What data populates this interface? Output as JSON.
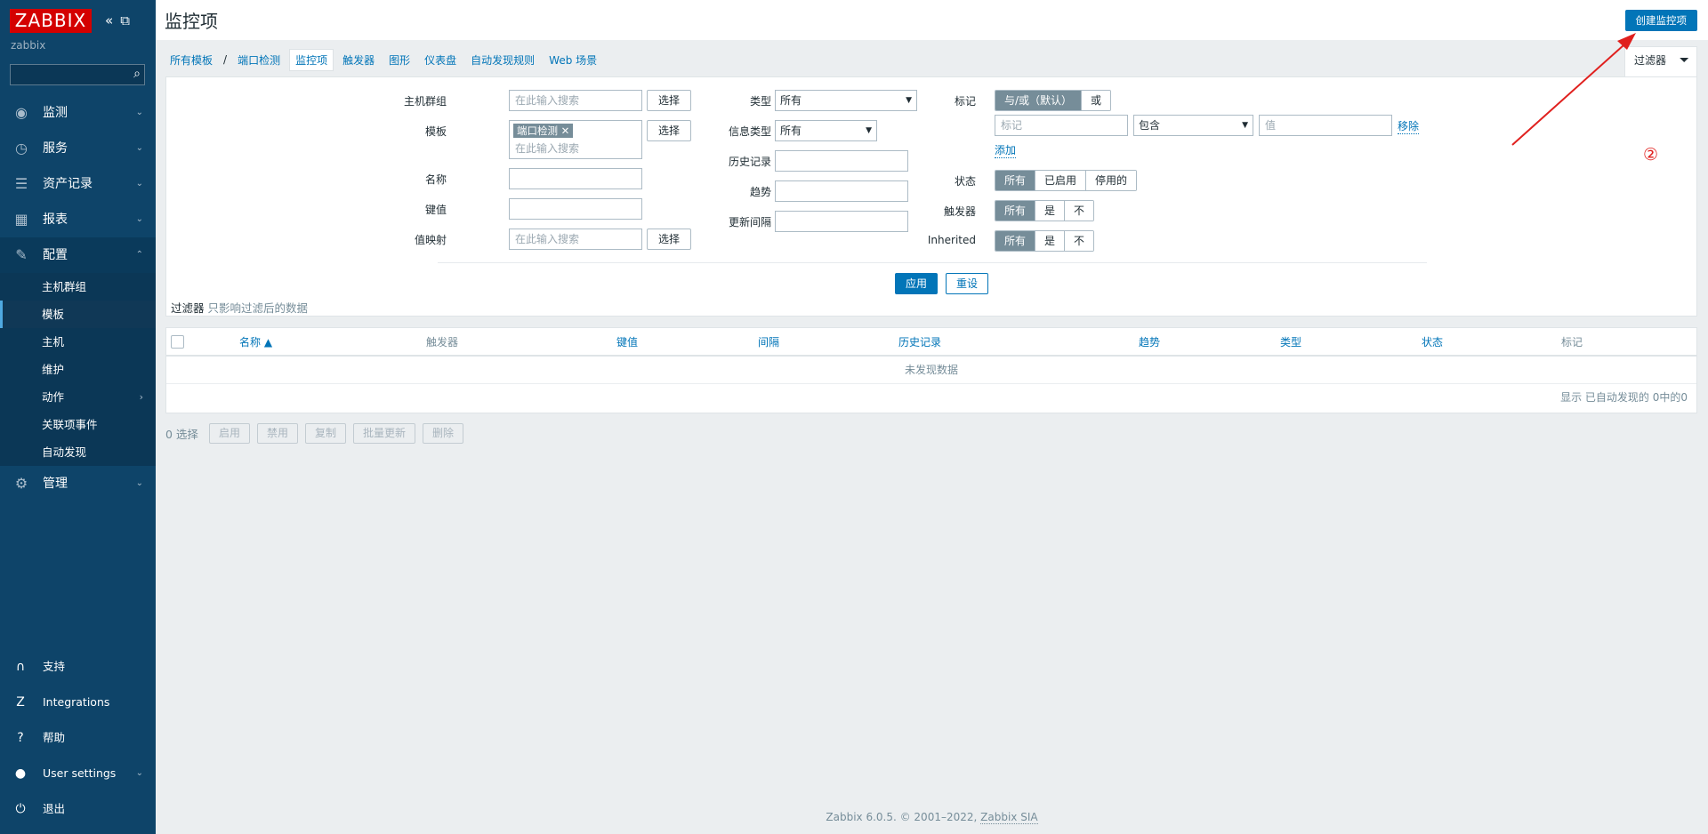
{
  "brand": {
    "logo": "ZABBIX",
    "server": "zabbix",
    "collapse_icon": "double-chevron-left-icon",
    "kiosk_icon": "kiosk-icon"
  },
  "sidebar": {
    "menu": [
      {
        "label": "监测",
        "icon": "eye-icon"
      },
      {
        "label": "服务",
        "icon": "clock-icon"
      },
      {
        "label": "资产记录",
        "icon": "list-icon"
      },
      {
        "label": "报表",
        "icon": "bar-chart-icon"
      },
      {
        "label": "配置",
        "icon": "wrench-icon"
      }
    ],
    "config_sub": [
      "主机群组",
      "模板",
      "主机",
      "维护",
      "动作",
      "关联项事件",
      "自动发现"
    ],
    "admin": "管理",
    "bottom": [
      {
        "label": "支持",
        "icon": "headset-icon"
      },
      {
        "label": "Integrations",
        "icon": "zabbix-z-icon"
      },
      {
        "label": "帮助",
        "icon": "question-icon"
      },
      {
        "label": "User settings",
        "icon": "user-icon"
      },
      {
        "label": "退出",
        "icon": "power-icon"
      }
    ]
  },
  "header": {
    "title": "监控项",
    "create_button": "创建监控项"
  },
  "tabs": {
    "all_templates": "所有模板",
    "sep": "/",
    "template": "端口检测",
    "items": "监控项",
    "triggers": "触发器",
    "graphs": "图形",
    "dashboards": "仪表盘",
    "discovery": "自动发现规则",
    "web": "Web 场景"
  },
  "filter": {
    "tab_label": "过滤器",
    "host_groups_label": "主机群组",
    "host_groups_placeholder": "在此输入搜索",
    "select": "选择",
    "templates_label": "模板",
    "template_chip": "端口检测",
    "templates_placeholder": "在此输入搜索",
    "name_label": "名称",
    "key_label": "键值",
    "valuemap_label": "值映射",
    "valuemap_placeholder": "在此输入搜索",
    "type_label": "类型",
    "type_value": "所有",
    "info_type_label": "信息类型",
    "info_type_value": "所有",
    "history_label": "历史记录",
    "trends_label": "趋势",
    "interval_label": "更新间隔",
    "tags_label": "标记",
    "tags_andor": "与/或（默认）",
    "tags_or": "或",
    "tag_placeholder": "标记",
    "tag_operator": "包含",
    "tag_value_placeholder": "值",
    "remove": "移除",
    "add": "添加",
    "status_label": "状态",
    "status_options": [
      "所有",
      "已启用",
      "停用的"
    ],
    "triggers_label": "触发器",
    "yes_no_options": [
      "所有",
      "是",
      "不"
    ],
    "inherited_label": "Inherited",
    "apply": "应用",
    "reset": "重设",
    "note_prefix": "过滤器",
    "note_text": "只影响过滤后的数据"
  },
  "table": {
    "columns": [
      "名称 ▲",
      "触发器",
      "键值",
      "间隔",
      "历史记录",
      "趋势",
      "类型",
      "状态",
      "标记"
    ],
    "empty": "未发现数据",
    "paging": "显示 已自动发现的 0中的0"
  },
  "actions": {
    "count": "0 选择",
    "buttons": [
      "启用",
      "禁用",
      "复制",
      "批量更新",
      "删除"
    ]
  },
  "footer": {
    "text": "Zabbix 6.0.5. © 2001–2022,",
    "link": "Zabbix SIA"
  },
  "annotation": {
    "marker": "②"
  },
  "colors": {
    "sidebar": "#0e4469",
    "accent": "#0275b8",
    "logo": "#d40000",
    "annotation": "#e0201e"
  }
}
